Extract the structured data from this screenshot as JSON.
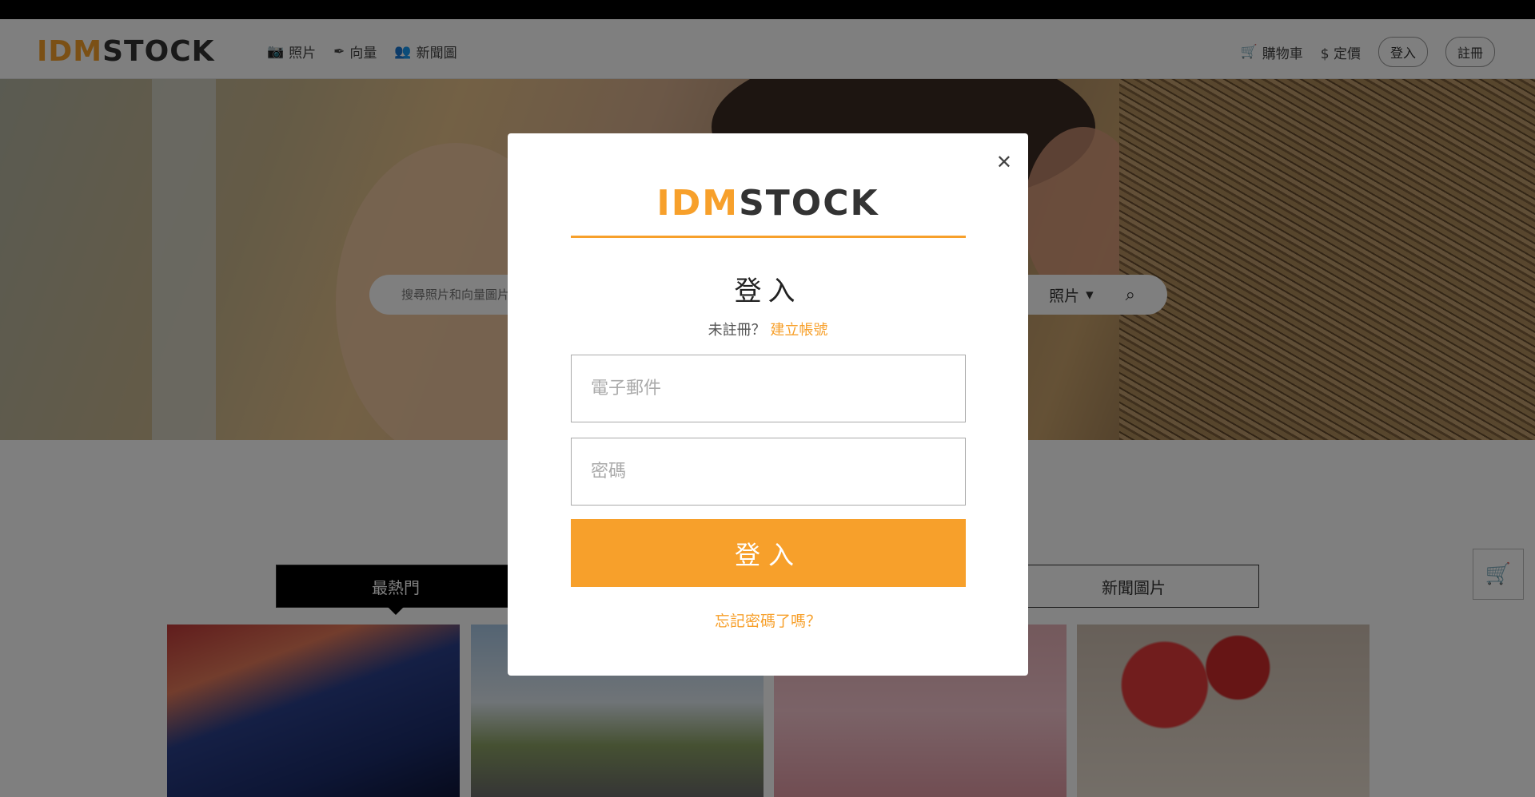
{
  "header": {
    "logo_idm": "IDM",
    "logo_stock": "STOCK",
    "nav": [
      {
        "icon": "camera-icon",
        "glyph": "📷",
        "label": "照片"
      },
      {
        "icon": "pen-icon",
        "glyph": "✒",
        "label": "向量"
      },
      {
        "icon": "users-icon",
        "glyph": "👥",
        "label": "新聞圖"
      }
    ],
    "cart_label": "購物車",
    "pricing_label": "$ 定價",
    "login_label": "登入",
    "register_label": "註冊"
  },
  "search": {
    "placeholder": "搜尋照片和向量圖片",
    "type_label": "照片"
  },
  "tabs": [
    {
      "label": "最熱門",
      "active": true
    },
    {
      "label": "新聞圖片",
      "active": false
    }
  ],
  "modal": {
    "logo_idm": "IDM",
    "logo_stock": "STOCK",
    "title": "登入",
    "not_registered": "未註冊？",
    "create_account": "建立帳號",
    "email_placeholder": "電子郵件",
    "password_placeholder": "密碼",
    "submit_label": "登入",
    "forgot_label": "忘記密碼了嗎？"
  },
  "colors": {
    "accent": "#f7a02b",
    "overlay": "rgba(0,0,0,0.5)"
  }
}
